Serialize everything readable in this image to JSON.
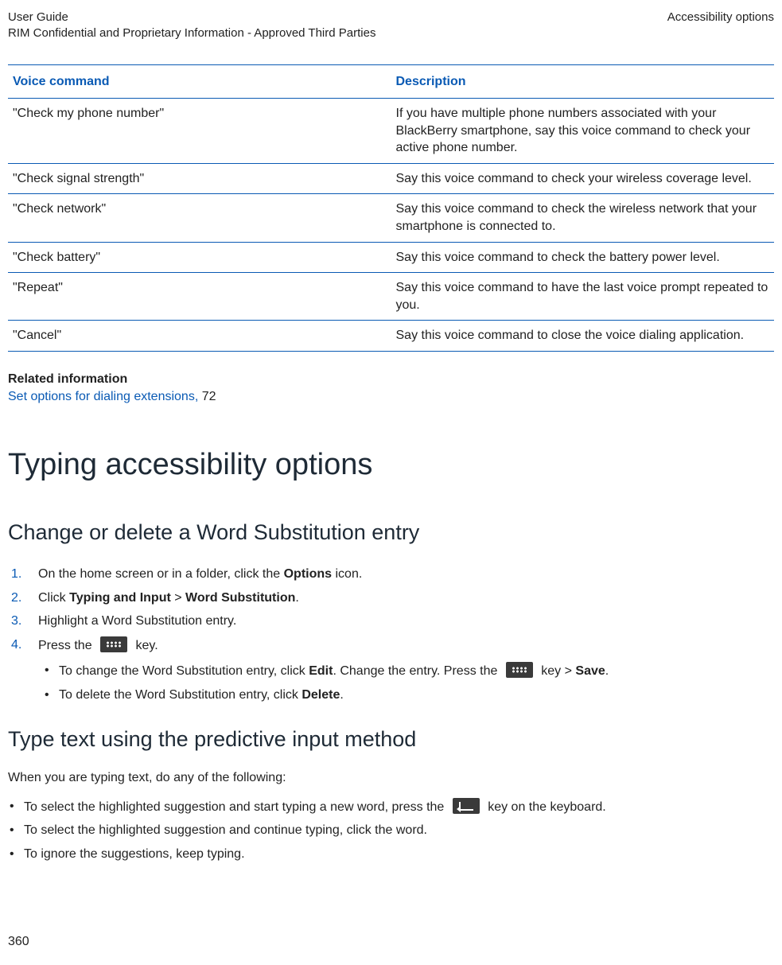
{
  "header": {
    "left_line1": "User Guide",
    "left_line2": "RIM Confidential and Proprietary Information - Approved Third Parties",
    "right": "Accessibility options"
  },
  "table": {
    "col1": "Voice command",
    "col2": "Description",
    "rows": [
      {
        "cmd": "\"Check my phone number\"",
        "desc": "If you have multiple phone numbers associated with your BlackBerry smartphone, say this voice command to check your active phone number."
      },
      {
        "cmd": "\"Check signal strength\"",
        "desc": "Say this voice command to check your wireless coverage level."
      },
      {
        "cmd": "\"Check network\"",
        "desc": "Say this voice command to check the wireless network that your smartphone is connected to."
      },
      {
        "cmd": "\"Check battery\"",
        "desc": "Say this voice command to check the battery power level."
      },
      {
        "cmd": "\"Repeat\"",
        "desc": "Say this voice command to have the last voice prompt repeated to you."
      },
      {
        "cmd": "\"Cancel\"",
        "desc": "Say this voice command to close the voice dialing application."
      }
    ]
  },
  "related": {
    "title": "Related information",
    "link_text": "Set options for dialing extensions, ",
    "page": "72"
  },
  "h1": "Typing accessibility options",
  "sec1": {
    "h2": "Change or delete a Word Substitution entry",
    "step1_a": "On the home screen or in a folder, click the ",
    "step1_b": "Options",
    "step1_c": " icon.",
    "step2_a": "Click ",
    "step2_b": "Typing and Input",
    "step2_c": " > ",
    "step2_d": "Word Substitution",
    "step2_e": ".",
    "step3": "Highlight a Word Substitution entry.",
    "step4_a": "Press the ",
    "step4_b": " key.",
    "sub1_a": "To change the Word Substitution entry, click ",
    "sub1_b": "Edit",
    "sub1_c": ". Change the entry. Press the ",
    "sub1_d": " key > ",
    "sub1_e": "Save",
    "sub1_f": ".",
    "sub2_a": "To delete the Word Substitution entry, click ",
    "sub2_b": "Delete",
    "sub2_c": "."
  },
  "sec2": {
    "h2": "Type text using the predictive input method",
    "intro": "When you are typing text, do any of the following:",
    "b1_a": "To select the highlighted suggestion and start typing a new word, press the ",
    "b1_b": " key on the keyboard.",
    "b2": "To select the highlighted suggestion and continue typing, click the word.",
    "b3": "To ignore the suggestions, keep typing."
  },
  "page_number": "360"
}
